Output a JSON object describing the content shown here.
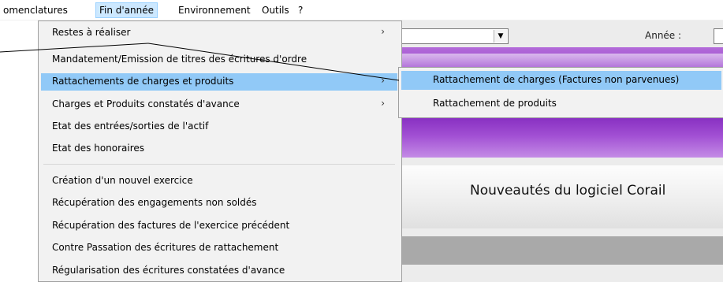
{
  "menubar": {
    "items": [
      {
        "label": "omenclatures"
      },
      {
        "label": "Fin d'année"
      },
      {
        "label": "Environnement"
      },
      {
        "label": "Outils"
      },
      {
        "label": "?"
      }
    ]
  },
  "background": {
    "year_label": "Année :",
    "news_title": "Nouveautés du logiciel Corail"
  },
  "dropdown": {
    "items": [
      {
        "label": "Restes à réaliser",
        "arrow": "›"
      },
      {
        "label": "Mandatement/Emission de titres des écritures d'ordre"
      },
      {
        "label": "Rattachements de charges et produits",
        "arrow": "›"
      },
      {
        "label": "Charges et Produits constatés d'avance",
        "arrow": "›"
      },
      {
        "label": "Etat des entrées/sorties de l'actif"
      },
      {
        "label": "Etat des honoraires"
      },
      {
        "label": "Création d'un nouvel exercice"
      },
      {
        "label": "Récupération des engagements non soldés"
      },
      {
        "label": "Récupération des factures de l'exercice précédent"
      },
      {
        "label": "Contre Passation des écritures de rattachement"
      },
      {
        "label": "Régularisation des écritures constatées d'avance"
      }
    ]
  },
  "submenu": {
    "items": [
      {
        "label": "Rattachement de charges (Factures non parvenues)"
      },
      {
        "label": "Rattachement de produits"
      }
    ]
  },
  "colors": {
    "highlight": "#91c9f7",
    "menubar_active": "#cce8ff",
    "banner": "#8c33c8"
  }
}
